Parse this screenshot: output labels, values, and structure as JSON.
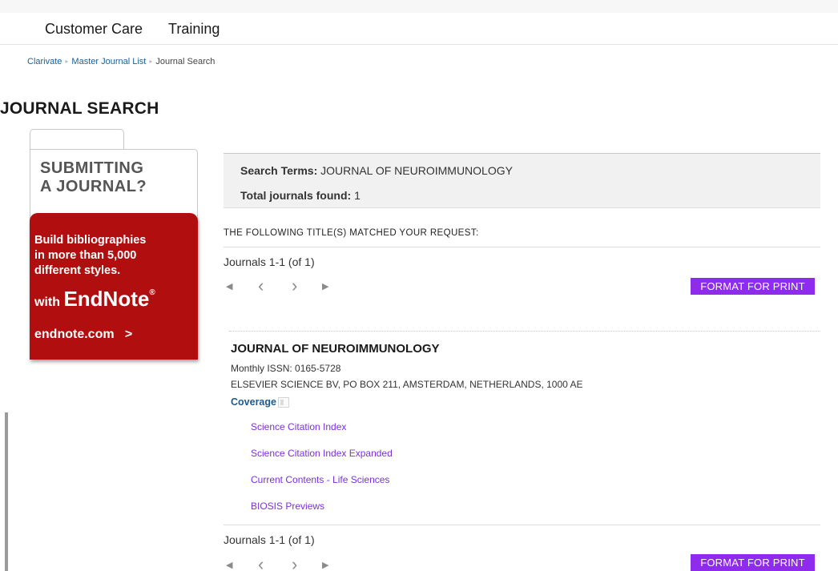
{
  "nav": {
    "items": [
      "Customer Care",
      "Training"
    ]
  },
  "breadcrumb": {
    "items": [
      "Clarivate",
      "Master Journal List",
      "Journal Search"
    ]
  },
  "page_title": "JOURNAL SEARCH",
  "ad": {
    "headline_1": "SUBMITTING",
    "headline_2": "A JOURNAL?",
    "body_1": "Build bibliographies",
    "body_2": "in more than 5,000",
    "body_3": "different styles.",
    "with": "with",
    "brand": "EndNote",
    "reg": "®",
    "link": "endnote.com",
    "link_arrow": ">",
    "accent_color": "#b10f0f"
  },
  "search": {
    "terms_label": "Search Terms:",
    "terms_value": "JOURNAL OF NEUROIMMUNOLOGY",
    "found_label": "Total journals found:",
    "found_value": "1"
  },
  "matched_heading": "THE FOLLOWING TITLE(S) MATCHED YOUR REQUEST:",
  "pagination": {
    "count_text": "Journals 1-1 (of 1)",
    "first_icon": "◀",
    "prev_icon": "‹",
    "next_icon": "›",
    "last_icon": "▶"
  },
  "print_button": {
    "label": "FORMAT FOR PRINT",
    "color": "#8e2bec"
  },
  "journal": {
    "title": "JOURNAL OF NEUROIMMUNOLOGY",
    "frequency_issn": "Monthly ISSN: 0165-5728",
    "publisher": "ELSEVIER SCIENCE BV, PO BOX 211, AMSTERDAM, NETHERLANDS, 1000 AE",
    "coverage_label": "Coverage",
    "indexes": [
      "Science Citation Index",
      "Science Citation Index Expanded",
      "Current Contents - Life Sciences",
      "BIOSIS Previews"
    ]
  }
}
